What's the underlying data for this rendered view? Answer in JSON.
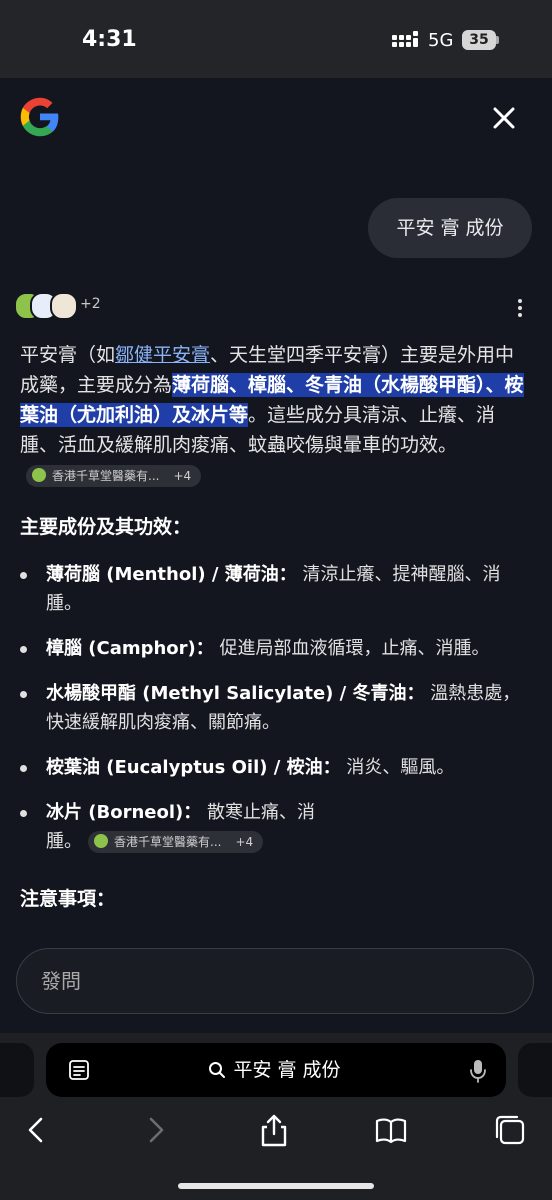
{
  "status": {
    "time": "4:31",
    "network": "5G",
    "battery": "35"
  },
  "header": {
    "logo_icon": "google-g-icon",
    "close_icon": "close-icon"
  },
  "query": "平安 膏 成份",
  "sources": {
    "more": "+2"
  },
  "answer": {
    "p1": "平安膏（如",
    "link": "鄒健平安膏",
    "p2": "、天生堂四季平安膏）主要是外用中成藥，主要成分為",
    "highlight": "薄荷腦、樟腦、冬青油（水楊酸甲酯）、桉葉油（尤加利油）及冰片等",
    "p3": "。這些成分具清涼、止癢、消腫、活血及緩解肌肉痠痛、蚊蟲咬傷與暈車的功效。",
    "chip_label": "香港千草堂醫藥有...",
    "chip_more": "+4"
  },
  "section1_title": "主要成份及其功效：",
  "bullets": [
    {
      "term": "薄荷腦 (Menthol) / 薄荷油：",
      "desc": " 清涼止癢、提神醒腦、消腫。"
    },
    {
      "term": "樟腦 (Camphor)：",
      "desc": " 促進局部血液循環，止痛、消腫。"
    },
    {
      "term": "水楊酸甲酯 (Methyl Salicylate) / 冬青油：",
      "desc": " 溫熱患處，快速緩解肌肉痠痛、關節痛。"
    },
    {
      "term": "桉葉油 (Eucalyptus Oil) / 桉油：",
      "desc": " 消炎、驅風。"
    },
    {
      "term": "冰片 (Borneol)：",
      "desc": " 散寒止痛、消腫。"
    }
  ],
  "bullet_chip_label": "香港千草堂醫藥有...",
  "bullet_chip_more": "+4",
  "section2_title": "注意事項：",
  "ask": {
    "placeholder": "發問"
  },
  "addressbar": {
    "text": "平安 膏 成份"
  },
  "colors": {
    "background": "#14161f",
    "highlight": "#1f3ea8",
    "link": "#8ab4f8"
  }
}
